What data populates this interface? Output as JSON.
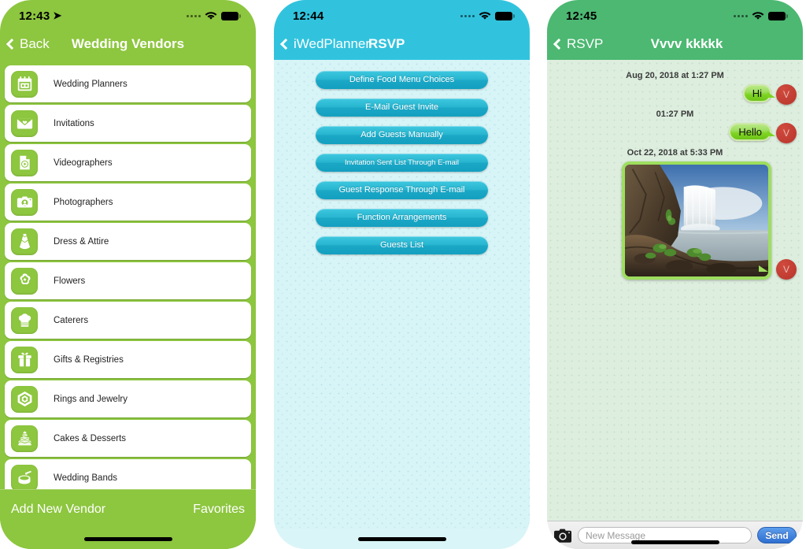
{
  "screens": {
    "vendors": {
      "status": {
        "time": "12:43",
        "location_icon": "location-arrow-icon"
      },
      "nav": {
        "back_label": "Back",
        "title": "Wedding Vendors"
      },
      "items": [
        {
          "label": "Wedding Planners",
          "icon": "calendar-icon"
        },
        {
          "label": "Invitations",
          "icon": "envelope-heart-icon"
        },
        {
          "label": "Videographers",
          "icon": "video-file-icon"
        },
        {
          "label": "Photographers",
          "icon": "camera-icon"
        },
        {
          "label": "Dress & Attire",
          "icon": "dress-icon"
        },
        {
          "label": "Flowers",
          "icon": "flower-star-icon"
        },
        {
          "label": "Caterers",
          "icon": "chef-hat-icon"
        },
        {
          "label": "Gifts & Registries",
          "icon": "gift-box-icon"
        },
        {
          "label": "Rings and Jewelry",
          "icon": "gem-icon"
        },
        {
          "label": "Cakes & Desserts",
          "icon": "wedding-cake-icon"
        },
        {
          "label": "Wedding Bands",
          "icon": "drum-icon"
        }
      ],
      "toolbar": {
        "add_label": "Add New Vendor",
        "favorites_label": "Favorites"
      },
      "accent": "#8dc63f"
    },
    "rsvp": {
      "status": {
        "time": "12:44"
      },
      "nav": {
        "back_label": "iWedPlanner",
        "title": "RSVP"
      },
      "buttons": [
        "Define Food Menu Choices",
        "E-Mail Guest Invite",
        "Add Guests Manually",
        "Invitation Sent List Through E-mail",
        "Guest Response Through E-mail",
        "Function Arrangements",
        "Guests List"
      ],
      "accent": "#31c3de"
    },
    "chat": {
      "status": {
        "time": "12:45"
      },
      "nav": {
        "back_label": "RSVP",
        "title": "Vvvv kkkkk"
      },
      "messages": [
        {
          "timestamp": "Aug 20, 2018 at 1:27 PM",
          "text": "Hi",
          "avatar": "V",
          "kind": "text"
        },
        {
          "timestamp": "01:27 PM",
          "text": "Hello",
          "avatar": "V",
          "kind": "text"
        },
        {
          "timestamp": "Oct 22, 2018 at 5:33 PM",
          "text": "",
          "avatar": "V",
          "kind": "photo",
          "photo_alt": "waterfall-photo"
        }
      ],
      "composer": {
        "camera_icon": "camera-icon",
        "placeholder": "New Message",
        "input_value": "",
        "send_label": "Send"
      },
      "accent": "#4cb872"
    }
  }
}
